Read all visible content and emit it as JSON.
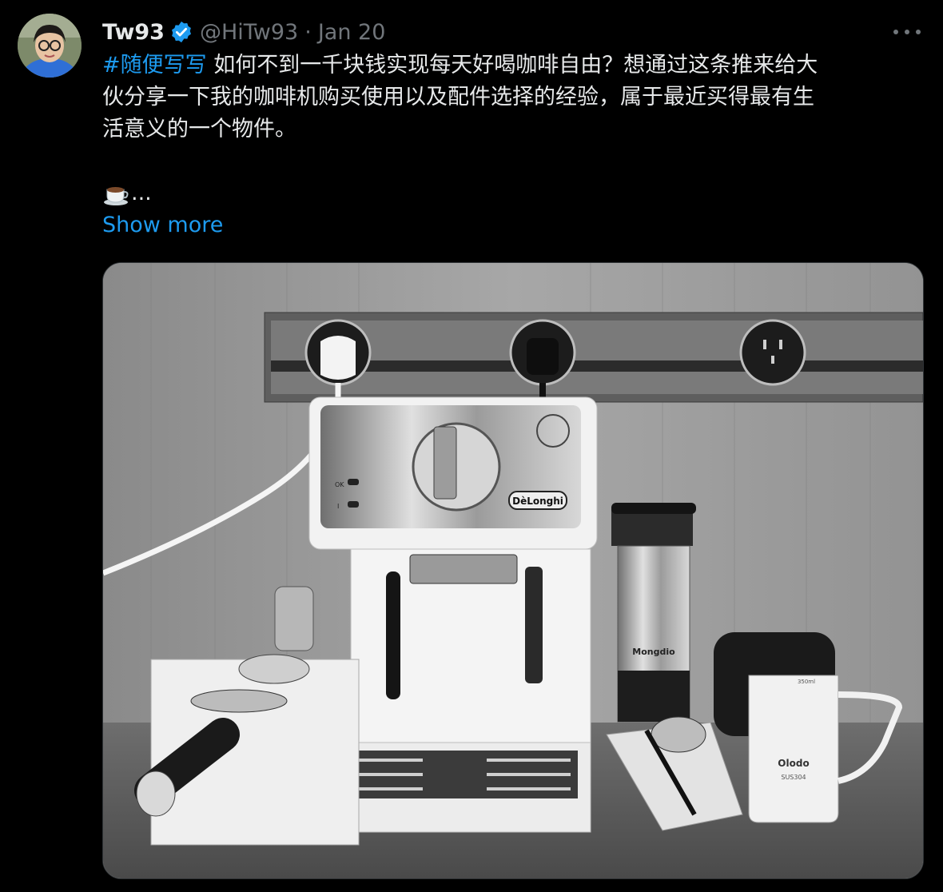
{
  "tweet": {
    "author_name": "Tw93",
    "author_handle": "@HiTw93",
    "separator": "·",
    "date": "Jan 20",
    "hashtag": "#随便写写",
    "text_line1": "如何不到一千块钱实现每天好喝咖啡自由？想通过这条推来给大",
    "text_line2": "伙分享一下我的咖啡机购买使用以及配件选择的经验，属于最近买得最有生",
    "text_line3": "活意义的一个物件。",
    "ellipsis": "...",
    "show_more": "Show more"
  },
  "photo": {
    "machine_brand": "DèLonghi",
    "ok_label": "OK",
    "power_label": "I",
    "grinder_brand": "Mongdio",
    "pitcher_brand": "Olodo",
    "pitcher_sub": "SUS304",
    "pitcher_scale": "350ml"
  },
  "icons": {
    "verified": "verified-badge-icon",
    "more": "more-horizontal-icon",
    "coffee": "coffee-cup-emoji"
  },
  "colors": {
    "background": "#000000",
    "text": "#e7e9ea",
    "secondary": "#71767b",
    "link": "#1d9bf0"
  }
}
